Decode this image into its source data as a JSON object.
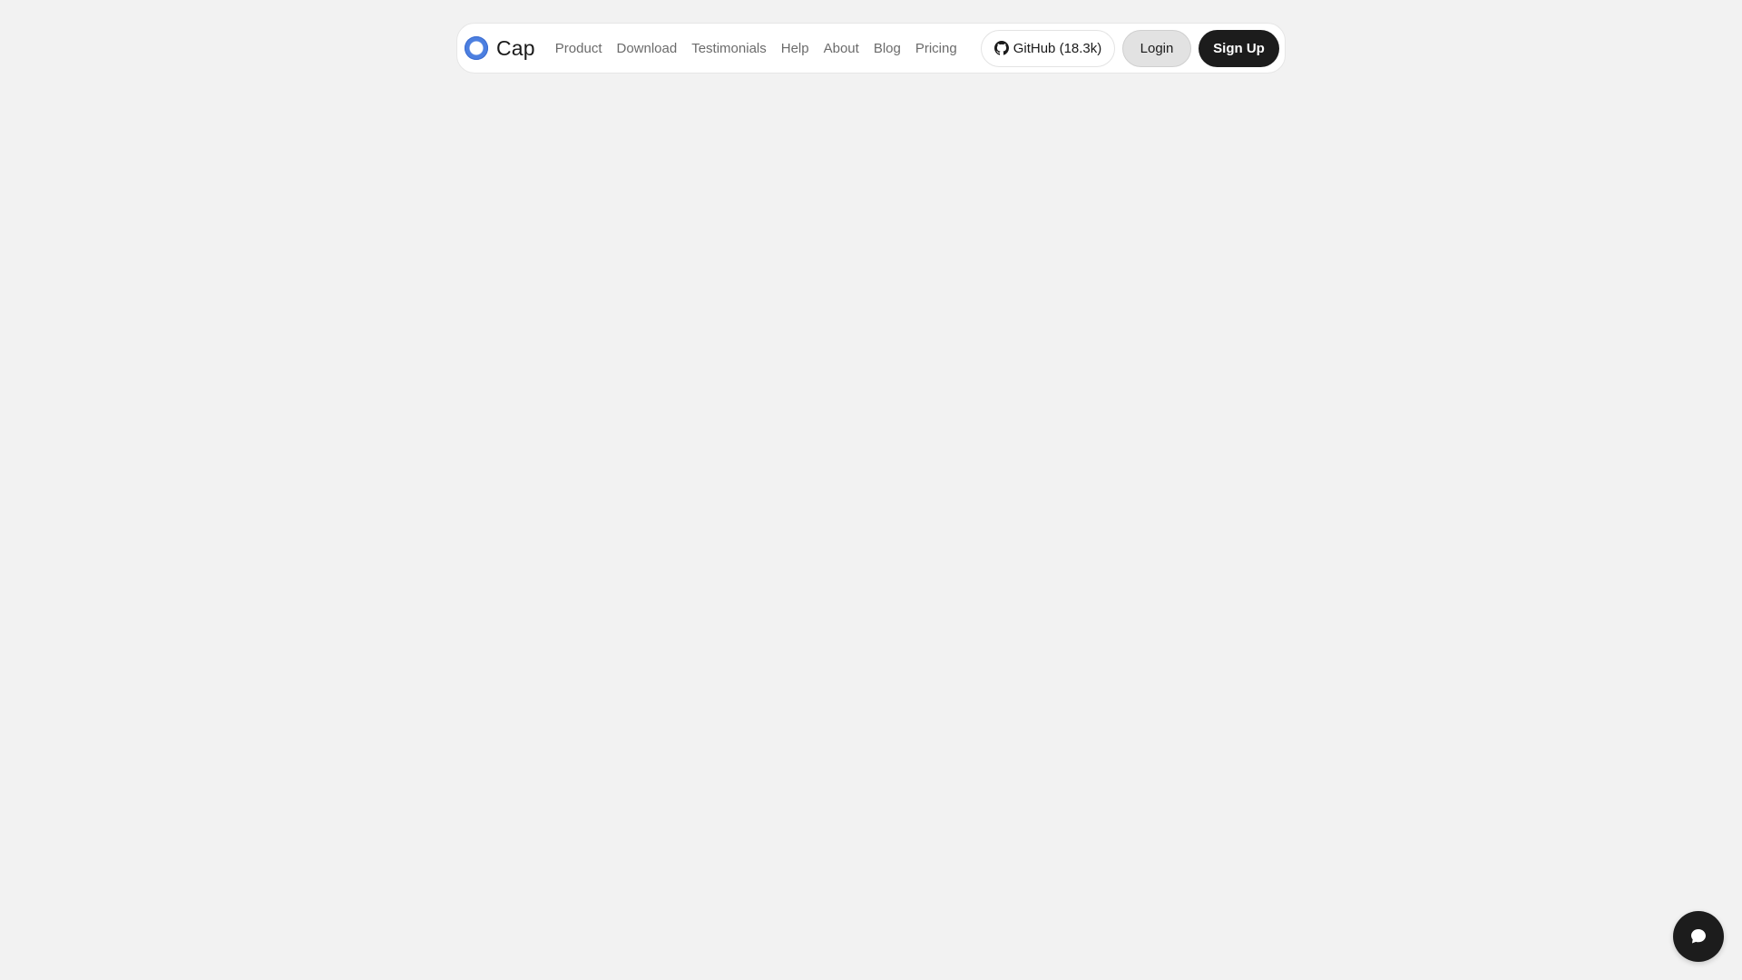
{
  "brand": {
    "name": "Cap",
    "logo_icon": "cap-logo-ring-icon",
    "accent_color": "#4c7fe0"
  },
  "nav": {
    "links": [
      {
        "label": "Product"
      },
      {
        "label": "Download"
      },
      {
        "label": "Testimonials"
      },
      {
        "label": "Help"
      },
      {
        "label": "About"
      },
      {
        "label": "Blog"
      },
      {
        "label": "Pricing"
      }
    ]
  },
  "actions": {
    "github_label": "GitHub (18.3k)",
    "github_icon": "github-icon",
    "login_label": "Login",
    "signup_label": "Sign Up"
  },
  "chat": {
    "icon": "chat-bubble-icon"
  }
}
